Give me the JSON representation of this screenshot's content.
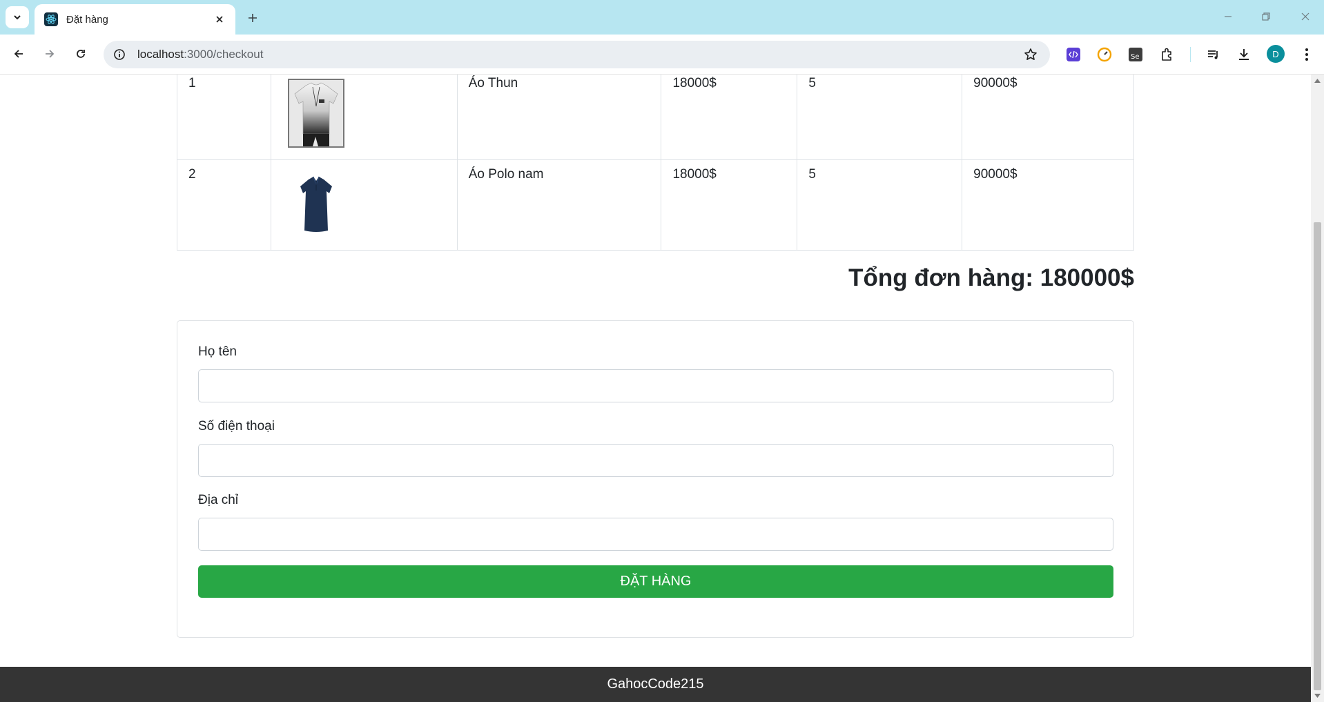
{
  "browser": {
    "tab_title": "Đặt hàng",
    "url_host": "localhost",
    "url_path": ":3000/checkout",
    "profile_initial": "D",
    "icons": [
      "tab-search-icon",
      "react-favicon-icon",
      "close-icon",
      "plus-icon",
      "minimize-icon",
      "restore-icon",
      "window-close-icon",
      "back-arrow-icon",
      "forward-arrow-icon",
      "reload-icon",
      "site-info-icon",
      "star-icon",
      "extension-icon",
      "puzzle-icon",
      "media-icon",
      "download-icon",
      "more-vert-icon"
    ]
  },
  "order": {
    "rows": [
      {
        "index": "1",
        "image": "white-tshirt",
        "name": "Áo Thun",
        "price": "18000$",
        "quantity": "5",
        "total": "90000$"
      },
      {
        "index": "2",
        "image": "navy-polo",
        "name": "Áo Polo nam",
        "price": "18000$",
        "quantity": "5",
        "total": "90000$"
      }
    ],
    "grand_total": "Tổng đơn hàng: 180000$"
  },
  "form": {
    "name_label": "Họ tên",
    "name_value": "",
    "phone_label": "Số điện thoại",
    "phone_value": "",
    "address_label": "Địa chỉ",
    "address_value": "",
    "submit_label": "ĐẶT HÀNG"
  },
  "footer": {
    "text": "GahocCode215"
  },
  "colors": {
    "chrome": "#b7e6f1",
    "submit": "#28a745",
    "footer": "#343434"
  }
}
